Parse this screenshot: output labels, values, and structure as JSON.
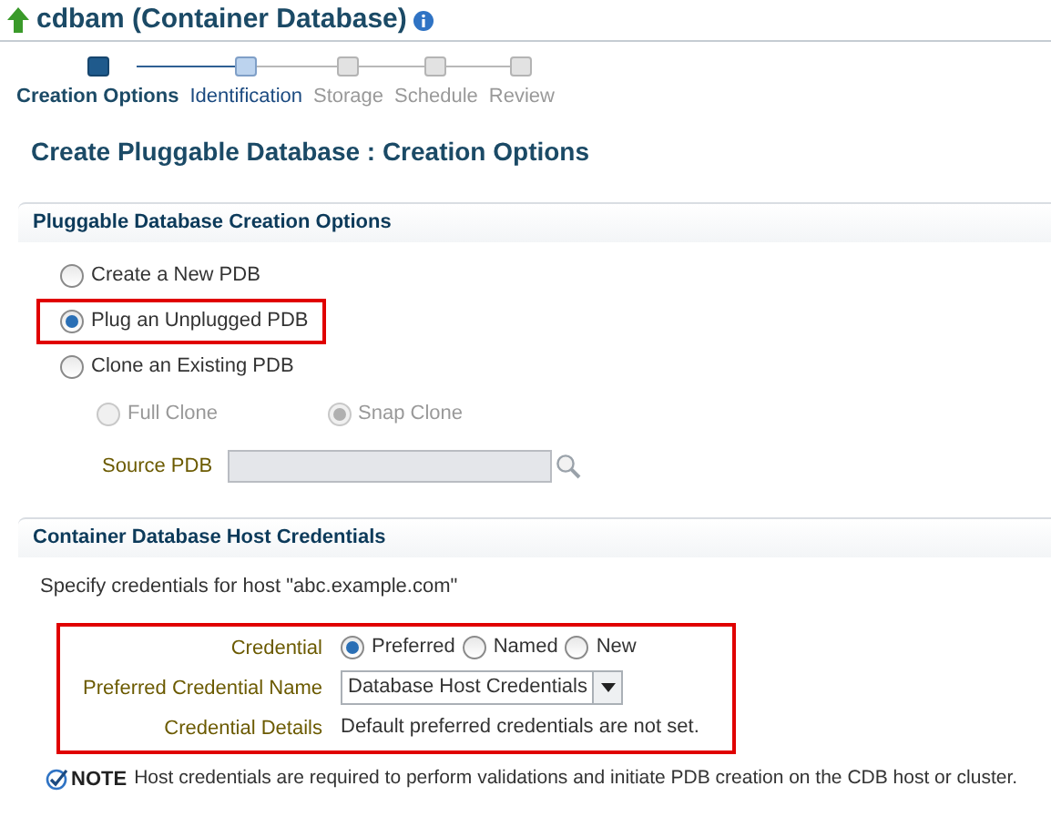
{
  "header": {
    "title": "cdbam (Container Database)"
  },
  "train": [
    {
      "label": "Creation Options",
      "selected": true,
      "disabled": false
    },
    {
      "label": "Identification",
      "selected": false,
      "disabled": false
    },
    {
      "label": "Storage",
      "selected": false,
      "disabled": true
    },
    {
      "label": "Schedule",
      "selected": false,
      "disabled": true
    },
    {
      "label": "Review",
      "selected": false,
      "disabled": true
    }
  ],
  "page_title": "Create Pluggable Database : Creation Options",
  "creation": {
    "title": "Pluggable Database Creation Options",
    "options": [
      {
        "label": "Create a New PDB",
        "selected": false,
        "highlighted": false
      },
      {
        "label": "Plug an Unplugged PDB",
        "selected": true,
        "highlighted": true
      },
      {
        "label": "Clone an Existing PDB",
        "selected": false,
        "highlighted": false
      }
    ],
    "clone_types": [
      {
        "label": "Full Clone",
        "selected": false,
        "disabled": true
      },
      {
        "label": "Snap Clone",
        "selected": true,
        "disabled": true
      }
    ],
    "source_pdb": {
      "label": "Source PDB",
      "disabled": true
    }
  },
  "credentials": {
    "title": "Container Database Host Credentials",
    "description": "Specify credentials for host \"abc.example.com\"",
    "highlighted": true,
    "credential": {
      "label": "Credential",
      "options": [
        {
          "label": "Preferred",
          "selected": true
        },
        {
          "label": "Named",
          "selected": false
        },
        {
          "label": "New",
          "selected": false
        }
      ]
    },
    "name": {
      "label": "Preferred Credential Name",
      "value": "Database Host Credentials"
    },
    "details": {
      "label": "Credential Details",
      "value": "Default preferred credentials are not set."
    }
  },
  "note": {
    "label": "NOTE",
    "text": "Host credentials are required to perform validations and initiate PDB creation on the CDB host or cluster."
  }
}
